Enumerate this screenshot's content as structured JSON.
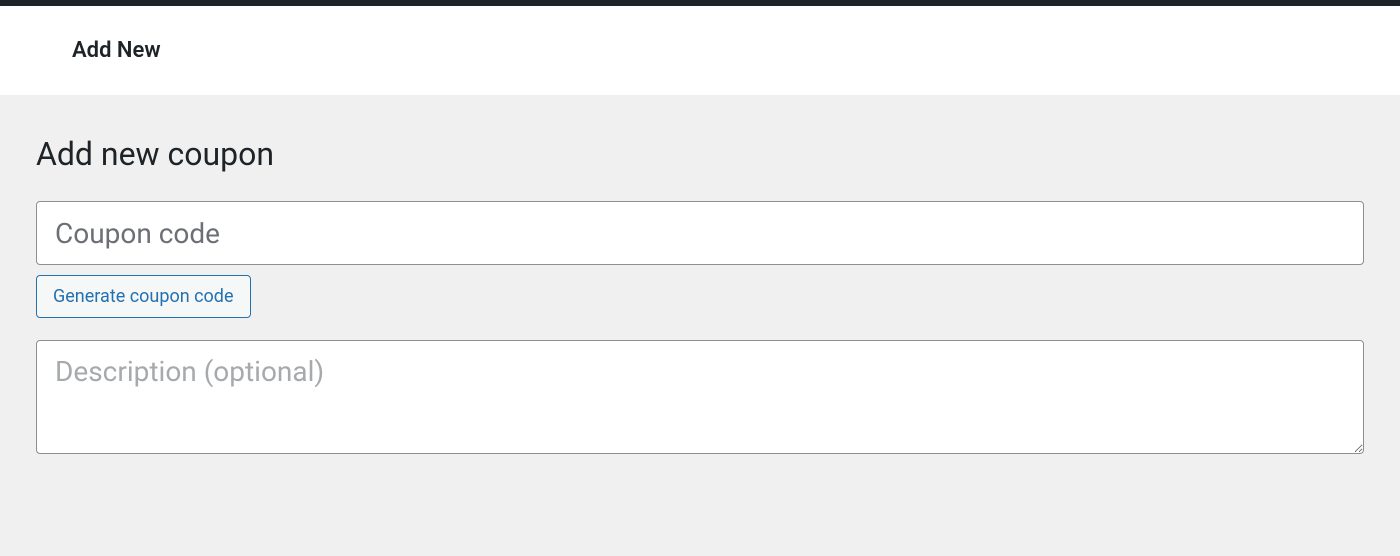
{
  "header": {
    "title": "Add New"
  },
  "page": {
    "heading": "Add new coupon"
  },
  "form": {
    "coupon_code": {
      "placeholder": "Coupon code",
      "value": ""
    },
    "generate_button_label": "Generate coupon code",
    "description": {
      "placeholder": "Description (optional)",
      "value": ""
    }
  }
}
